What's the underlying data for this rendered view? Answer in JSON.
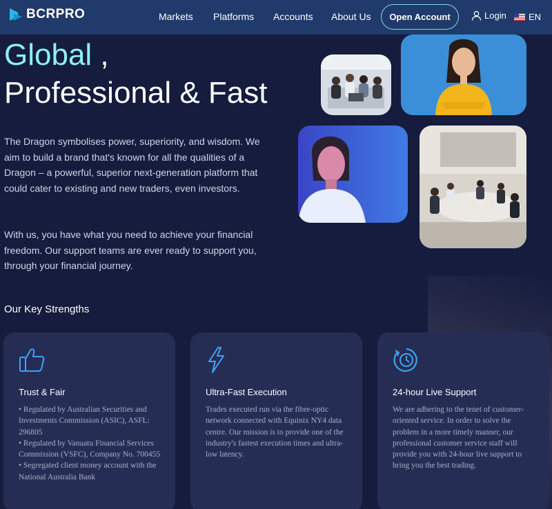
{
  "nav": {
    "brand": "BCRPRO",
    "links": [
      "Markets",
      "Platforms",
      "Accounts",
      "About Us"
    ],
    "open_account": "Open Account",
    "login": "Login",
    "language": "EN"
  },
  "hero": {
    "title_accent": "Global",
    "title_comma": " ,",
    "title_line2": "Professional & Fast",
    "paragraph1": "The Dragon symbolises power, superiority, and wisdom. We aim to build a brand that's known for all the qualities of a Dragon – a powerful, superior next-generation platform that could cater to existing and new traders, even investors.",
    "paragraph2": "With us, you have what you need to achieve your financial freedom. Our support teams are ever ready to support you, through your financial journey."
  },
  "photos": [
    "team-meeting-photo",
    "smiling-woman-photo",
    "woman-portrait-photo",
    "conference-room-photo"
  ],
  "strengths": {
    "title": "Our Key Strengths",
    "cards": [
      {
        "icon": "thumbs-up-icon",
        "title": "Trust & Fair",
        "lines": [
          "• Regulated by Australian Securities and Investments Commission (ASIC), ASFL: 296805",
          "• Regulated by Vanuatu Financial Services Commission (VSFC), Company No. 700455",
          "• Segregated client money account with the National Australia Bank"
        ]
      },
      {
        "icon": "lightning-icon",
        "title": "Ultra-Fast Execution",
        "lines": [
          "Trades executed run via the fibre-optic network connected with Equinix NY4 data centre. Our mission is to provide one of the industry's fastest execution times and ultra-low latency."
        ]
      },
      {
        "icon": "clock-icon",
        "title": "24-hour Live Support",
        "lines": [
          "We are adhering to the tenet of customer-oriented service. In order to solve the problem in a more timely manner, our professional customer service staff will provide you with 24-hour live support to bring you the best trading."
        ]
      }
    ]
  },
  "colors": {
    "nav_bg": "#1f3a6b",
    "page_bg": "#151c3d",
    "card_bg": "#262d55",
    "accent": "#8ef0f0",
    "icon_blue": "#3fa4f0"
  }
}
